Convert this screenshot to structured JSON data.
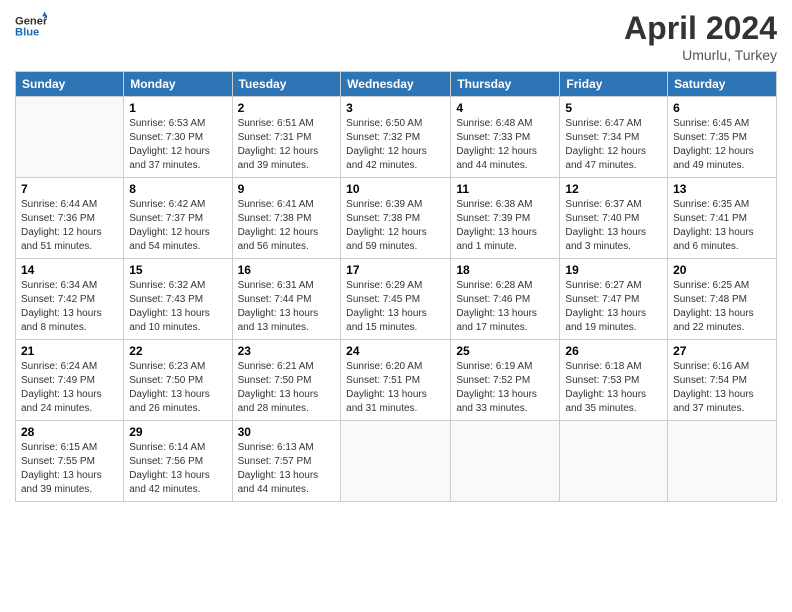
{
  "header": {
    "logo_line1": "General",
    "logo_line2": "Blue",
    "month": "April 2024",
    "location": "Umurlu, Turkey"
  },
  "weekdays": [
    "Sunday",
    "Monday",
    "Tuesday",
    "Wednesday",
    "Thursday",
    "Friday",
    "Saturday"
  ],
  "weeks": [
    [
      {
        "day": "",
        "sunrise": "",
        "sunset": "",
        "daylight": ""
      },
      {
        "day": "1",
        "sunrise": "Sunrise: 6:53 AM",
        "sunset": "Sunset: 7:30 PM",
        "daylight": "Daylight: 12 hours and 37 minutes."
      },
      {
        "day": "2",
        "sunrise": "Sunrise: 6:51 AM",
        "sunset": "Sunset: 7:31 PM",
        "daylight": "Daylight: 12 hours and 39 minutes."
      },
      {
        "day": "3",
        "sunrise": "Sunrise: 6:50 AM",
        "sunset": "Sunset: 7:32 PM",
        "daylight": "Daylight: 12 hours and 42 minutes."
      },
      {
        "day": "4",
        "sunrise": "Sunrise: 6:48 AM",
        "sunset": "Sunset: 7:33 PM",
        "daylight": "Daylight: 12 hours and 44 minutes."
      },
      {
        "day": "5",
        "sunrise": "Sunrise: 6:47 AM",
        "sunset": "Sunset: 7:34 PM",
        "daylight": "Daylight: 12 hours and 47 minutes."
      },
      {
        "day": "6",
        "sunrise": "Sunrise: 6:45 AM",
        "sunset": "Sunset: 7:35 PM",
        "daylight": "Daylight: 12 hours and 49 minutes."
      }
    ],
    [
      {
        "day": "7",
        "sunrise": "Sunrise: 6:44 AM",
        "sunset": "Sunset: 7:36 PM",
        "daylight": "Daylight: 12 hours and 51 minutes."
      },
      {
        "day": "8",
        "sunrise": "Sunrise: 6:42 AM",
        "sunset": "Sunset: 7:37 PM",
        "daylight": "Daylight: 12 hours and 54 minutes."
      },
      {
        "day": "9",
        "sunrise": "Sunrise: 6:41 AM",
        "sunset": "Sunset: 7:38 PM",
        "daylight": "Daylight: 12 hours and 56 minutes."
      },
      {
        "day": "10",
        "sunrise": "Sunrise: 6:39 AM",
        "sunset": "Sunset: 7:38 PM",
        "daylight": "Daylight: 12 hours and 59 minutes."
      },
      {
        "day": "11",
        "sunrise": "Sunrise: 6:38 AM",
        "sunset": "Sunset: 7:39 PM",
        "daylight": "Daylight: 13 hours and 1 minute."
      },
      {
        "day": "12",
        "sunrise": "Sunrise: 6:37 AM",
        "sunset": "Sunset: 7:40 PM",
        "daylight": "Daylight: 13 hours and 3 minutes."
      },
      {
        "day": "13",
        "sunrise": "Sunrise: 6:35 AM",
        "sunset": "Sunset: 7:41 PM",
        "daylight": "Daylight: 13 hours and 6 minutes."
      }
    ],
    [
      {
        "day": "14",
        "sunrise": "Sunrise: 6:34 AM",
        "sunset": "Sunset: 7:42 PM",
        "daylight": "Daylight: 13 hours and 8 minutes."
      },
      {
        "day": "15",
        "sunrise": "Sunrise: 6:32 AM",
        "sunset": "Sunset: 7:43 PM",
        "daylight": "Daylight: 13 hours and 10 minutes."
      },
      {
        "day": "16",
        "sunrise": "Sunrise: 6:31 AM",
        "sunset": "Sunset: 7:44 PM",
        "daylight": "Daylight: 13 hours and 13 minutes."
      },
      {
        "day": "17",
        "sunrise": "Sunrise: 6:29 AM",
        "sunset": "Sunset: 7:45 PM",
        "daylight": "Daylight: 13 hours and 15 minutes."
      },
      {
        "day": "18",
        "sunrise": "Sunrise: 6:28 AM",
        "sunset": "Sunset: 7:46 PM",
        "daylight": "Daylight: 13 hours and 17 minutes."
      },
      {
        "day": "19",
        "sunrise": "Sunrise: 6:27 AM",
        "sunset": "Sunset: 7:47 PM",
        "daylight": "Daylight: 13 hours and 19 minutes."
      },
      {
        "day": "20",
        "sunrise": "Sunrise: 6:25 AM",
        "sunset": "Sunset: 7:48 PM",
        "daylight": "Daylight: 13 hours and 22 minutes."
      }
    ],
    [
      {
        "day": "21",
        "sunrise": "Sunrise: 6:24 AM",
        "sunset": "Sunset: 7:49 PM",
        "daylight": "Daylight: 13 hours and 24 minutes."
      },
      {
        "day": "22",
        "sunrise": "Sunrise: 6:23 AM",
        "sunset": "Sunset: 7:50 PM",
        "daylight": "Daylight: 13 hours and 26 minutes."
      },
      {
        "day": "23",
        "sunrise": "Sunrise: 6:21 AM",
        "sunset": "Sunset: 7:50 PM",
        "daylight": "Daylight: 13 hours and 28 minutes."
      },
      {
        "day": "24",
        "sunrise": "Sunrise: 6:20 AM",
        "sunset": "Sunset: 7:51 PM",
        "daylight": "Daylight: 13 hours and 31 minutes."
      },
      {
        "day": "25",
        "sunrise": "Sunrise: 6:19 AM",
        "sunset": "Sunset: 7:52 PM",
        "daylight": "Daylight: 13 hours and 33 minutes."
      },
      {
        "day": "26",
        "sunrise": "Sunrise: 6:18 AM",
        "sunset": "Sunset: 7:53 PM",
        "daylight": "Daylight: 13 hours and 35 minutes."
      },
      {
        "day": "27",
        "sunrise": "Sunrise: 6:16 AM",
        "sunset": "Sunset: 7:54 PM",
        "daylight": "Daylight: 13 hours and 37 minutes."
      }
    ],
    [
      {
        "day": "28",
        "sunrise": "Sunrise: 6:15 AM",
        "sunset": "Sunset: 7:55 PM",
        "daylight": "Daylight: 13 hours and 39 minutes."
      },
      {
        "day": "29",
        "sunrise": "Sunrise: 6:14 AM",
        "sunset": "Sunset: 7:56 PM",
        "daylight": "Daylight: 13 hours and 42 minutes."
      },
      {
        "day": "30",
        "sunrise": "Sunrise: 6:13 AM",
        "sunset": "Sunset: 7:57 PM",
        "daylight": "Daylight: 13 hours and 44 minutes."
      },
      {
        "day": "",
        "sunrise": "",
        "sunset": "",
        "daylight": ""
      },
      {
        "day": "",
        "sunrise": "",
        "sunset": "",
        "daylight": ""
      },
      {
        "day": "",
        "sunrise": "",
        "sunset": "",
        "daylight": ""
      },
      {
        "day": "",
        "sunrise": "",
        "sunset": "",
        "daylight": ""
      }
    ]
  ]
}
